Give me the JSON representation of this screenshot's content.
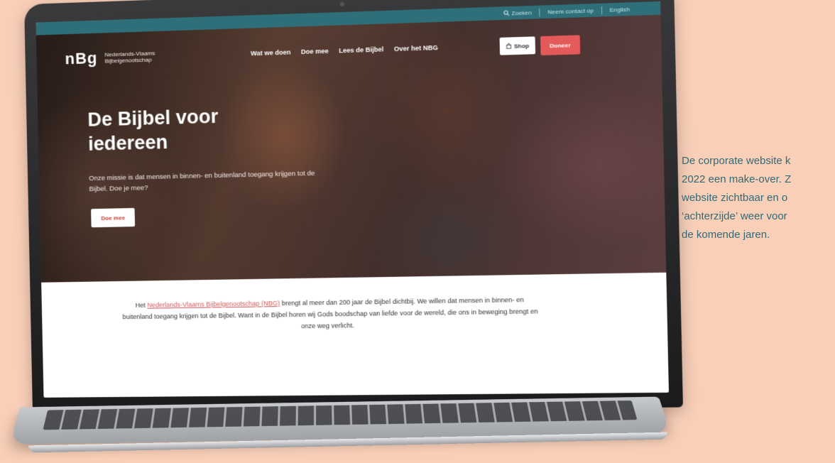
{
  "site": {
    "utility_bar": {
      "search_label": "Zoeken",
      "contact_label": "Neem contact op",
      "language_label": "English"
    },
    "logo": {
      "mark": "nBg",
      "name_line1": "Nederlands-Vlaams",
      "name_line2": "Bijbelgenootschap"
    },
    "nav": {
      "items": [
        "Wat we doen",
        "Doe mee",
        "Lees de Bijbel",
        "Over het NBG"
      ]
    },
    "shop_label": "Shop",
    "doneer_label": "Doneer",
    "hero": {
      "title_line1": "De Bijbel voor",
      "title_line2": "iedereen",
      "subtitle": "Onze missie is dat mensen in binnen- en buitenland toegang krijgen tot de Bijbel. Doe je mee?",
      "cta_label": "Doe mee"
    },
    "intro": {
      "prefix": "Het ",
      "link_text": "Nederlands-Vlaams Bijbelgenootschap (NBG)",
      "text": " brengt al meer dan 200 jaar de Bijbel dichtbij. We willen dat mensen in binnen- en buitenland toegang krijgen tot de Bijbel. Want in de Bijbel horen wij Gods boodschap van liefde voor de wereld, die ons in beweging brengt en onze weg verlicht."
    }
  },
  "caption": {
    "line1": "De corporate website k",
    "line2": "2022 een make-over. Z",
    "line3": "website zichtbaar en o",
    "line4": "‘achterzijde’ weer voor",
    "line5": "de komende jaren."
  },
  "colors": {
    "background": "#f9cfb8",
    "utility_bar": "#2f6f79",
    "donate_button": "#e45a5a",
    "caption_text": "#2f6b78",
    "link": "#d05a5a"
  },
  "icons": {
    "search": "search-icon",
    "shop": "bag-icon"
  }
}
